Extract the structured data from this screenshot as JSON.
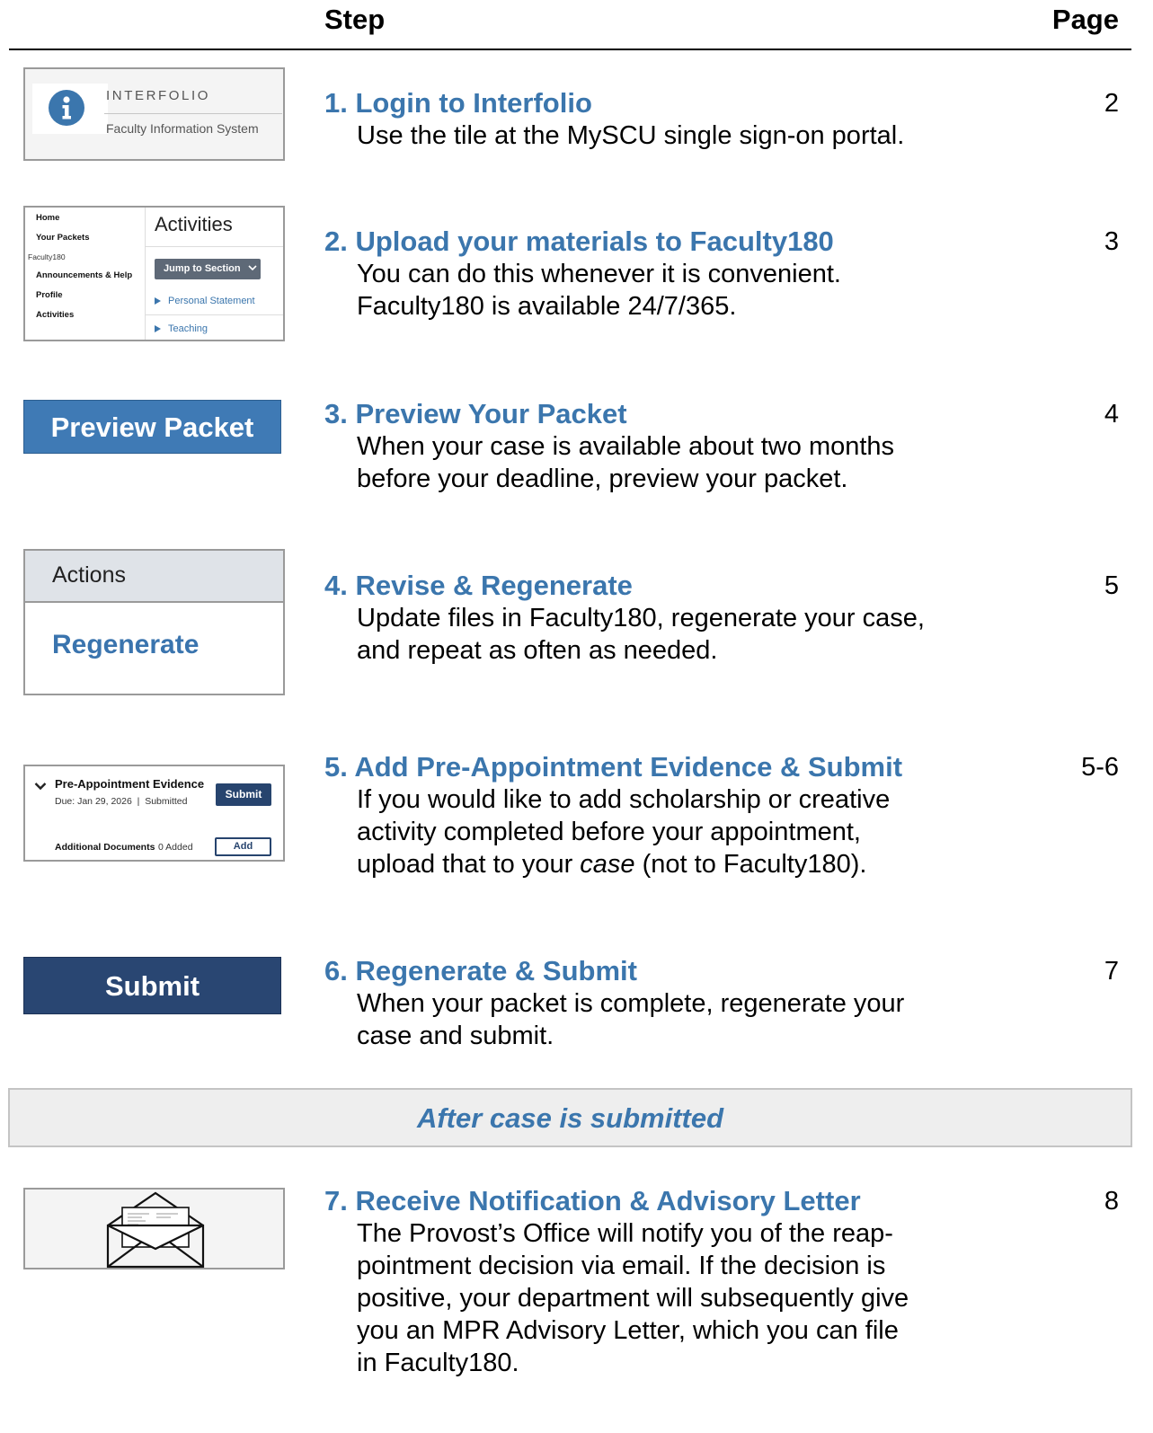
{
  "header": {
    "step_label": "Step",
    "page_label": "Page"
  },
  "steps": [
    {
      "title": "1. Login to Interfolio",
      "desc": "Use the tile at the MySCU single sign-on portal.",
      "page": "2"
    },
    {
      "title": "2. Upload your materials to Faculty180",
      "desc_lines": [
        "You can do this whenever it is convenient.",
        "Faculty180 is available 24/7/365."
      ],
      "page": "3"
    },
    {
      "title": "3. Preview Your Packet",
      "desc_lines": [
        "When your case is available about two months",
        "before your deadline, preview your packet."
      ],
      "page": "4"
    },
    {
      "title": "4. Revise & Regenerate",
      "desc_lines": [
        "Update files in Faculty180, regenerate your case,",
        "and repeat as often as needed."
      ],
      "page": "5"
    },
    {
      "title": "5. Add Pre-Appointment Evidence & Submit",
      "desc_lines": [
        "If you would like to add scholarship or creative",
        "activity completed before your appointment,"
      ],
      "desc_last_pre": "upload that to your ",
      "desc_last_em": "case",
      "desc_last_post": " (not to Faculty180).",
      "page": "5-6"
    },
    {
      "title": "6. Regenerate & Submit",
      "desc_lines": [
        "When your packet is complete, regenerate your",
        "case and submit."
      ],
      "page": "7"
    },
    {
      "title": "7. Receive Notification & Advisory Letter",
      "desc_lines": [
        "The Provost’s Office will notify you of the reap-",
        "pointment decision via email. If the decision is",
        "positive, your department will subsequently give",
        "you an MPR Advisory Letter, which you can file",
        "in Faculty180."
      ],
      "page": "8"
    }
  ],
  "banner": {
    "text": "After case is submitted"
  },
  "thumbs": {
    "interfolio": {
      "icon": "info-icon",
      "name": "INTERFOLIO",
      "sub": "Faculty Information System",
      "color": "#3b76ad"
    },
    "faculty180": {
      "nav": [
        "Home",
        "Your Packets",
        "Announcements & Help",
        "Profile",
        "Activities"
      ],
      "nav_sub": "Faculty180",
      "heading": "Activities",
      "jump": "Jump to Section",
      "items": [
        "Personal Statement",
        "Teaching"
      ]
    },
    "preview": {
      "label": "Preview Packet",
      "color": "#3f7ab5"
    },
    "actions": {
      "header": "Actions",
      "regenerate": "Regenerate"
    },
    "evidence": {
      "title": "Pre-Appointment Evidence",
      "due": "Due: Jan 29, 2026  |  Submitted",
      "submit": "Submit",
      "add_label": "Additional Documents",
      "added": "0 Added",
      "add": "Add"
    },
    "submit": {
      "label": "Submit",
      "color": "#294672"
    },
    "envelope": {
      "icon": "envelope-letter-icon"
    }
  }
}
